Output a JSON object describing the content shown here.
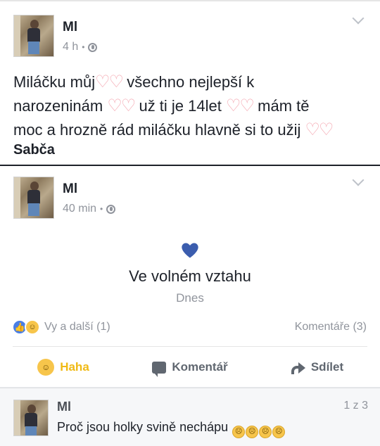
{
  "post1": {
    "author": "Ml",
    "time": "4 h",
    "text_line1": "Miláčku můj",
    "text_line1b": " všechno nejlepší k",
    "text_line2": "narozeninám ",
    "text_line2b": " už ti je 14let ",
    "text_line2c": " mám tě",
    "text_line3": "moc a hrozně rád miláčku hlavně si to užij ",
    "signature": "Sabča",
    "hearts_emoji": "♡♡"
  },
  "post2": {
    "author": "Ml",
    "time": "40 min",
    "life_event_title": "Ve volném vztahu",
    "life_event_date": "Dnes",
    "reactions_text": "Vy a další (1)",
    "comments_count": "Komentáře (3)",
    "actions": {
      "haha_label": "Haha",
      "comment_label": "Komentář",
      "share_label": "Sdílet"
    }
  },
  "comment": {
    "author": "Ml",
    "text": "Proč jsou holky svině nechápu",
    "pagination": "1 z 3"
  },
  "colors": {
    "brand_blue": "#4267b2",
    "heart_blue": "#3b5dae",
    "haha_yellow": "#f0ba15",
    "meta_gray": "#90949c"
  }
}
